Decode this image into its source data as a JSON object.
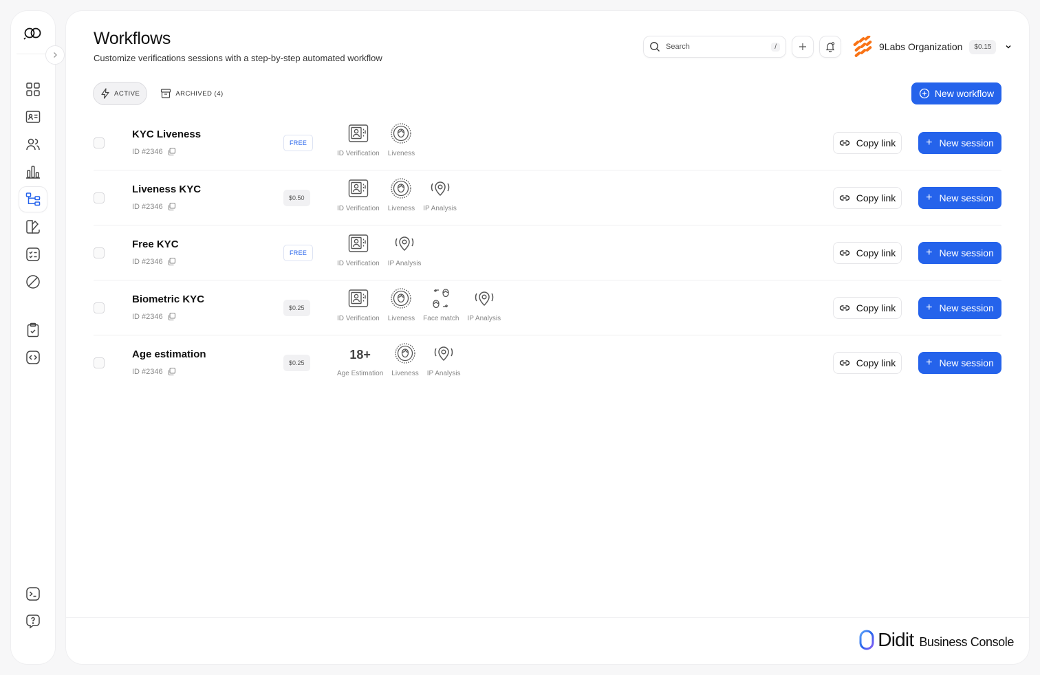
{
  "header": {
    "title": "Workflows",
    "subtitle": "Customize verifications sessions with a step-by-step automated workflow",
    "search_placeholder": "Search",
    "search_shortcut": "/",
    "org_name": "9Labs Organization",
    "org_credit": "$0.15"
  },
  "tabs": [
    {
      "label": "ACTIVE",
      "icon": "lightning-icon"
    },
    {
      "label": "ARCHIVED (4)",
      "icon": "archive-icon"
    }
  ],
  "new_workflow_label": "New workflow",
  "row_actions": {
    "copy_link": "Copy link",
    "new_session": "New session"
  },
  "workflows": [
    {
      "name": "KYC Liveness",
      "id": "ID #2346",
      "price": "FREE",
      "steps": [
        {
          "label": "ID Verification",
          "icon": "id-card-icon"
        },
        {
          "label": "Liveness",
          "icon": "face-scan-icon"
        }
      ]
    },
    {
      "name": "Liveness KYC",
      "id": "ID #2346",
      "price": "$0.50",
      "steps": [
        {
          "label": "ID Verification",
          "icon": "id-card-icon"
        },
        {
          "label": "Liveness",
          "icon": "face-scan-icon"
        },
        {
          "label": "IP Analysis",
          "icon": "location-pin-icon"
        }
      ]
    },
    {
      "name": "Free KYC",
      "id": "ID #2346",
      "price": "FREE",
      "steps": [
        {
          "label": "ID Verification",
          "icon": "id-card-icon"
        },
        {
          "label": "IP Analysis",
          "icon": "location-pin-icon"
        }
      ]
    },
    {
      "name": "Biometric KYC",
      "id": "ID #2346",
      "price": "$0.25",
      "steps": [
        {
          "label": "ID Verification",
          "icon": "id-card-icon"
        },
        {
          "label": "Liveness",
          "icon": "face-scan-icon"
        },
        {
          "label": "Face match",
          "icon": "face-match-icon"
        },
        {
          "label": "IP Analysis",
          "icon": "location-pin-icon"
        }
      ]
    },
    {
      "name": "Age estimation",
      "id": "ID #2346",
      "price": "$0.25",
      "steps": [
        {
          "label": "Age Estimation",
          "icon": "age-icon",
          "text": "18+"
        },
        {
          "label": "Liveness",
          "icon": "face-scan-icon"
        },
        {
          "label": "IP Analysis",
          "icon": "location-pin-icon"
        }
      ]
    }
  ],
  "footer": {
    "brand": "Didit",
    "product": "Business Console"
  },
  "colors": {
    "accent": "#2563eb",
    "org_logo": "#f97316"
  }
}
